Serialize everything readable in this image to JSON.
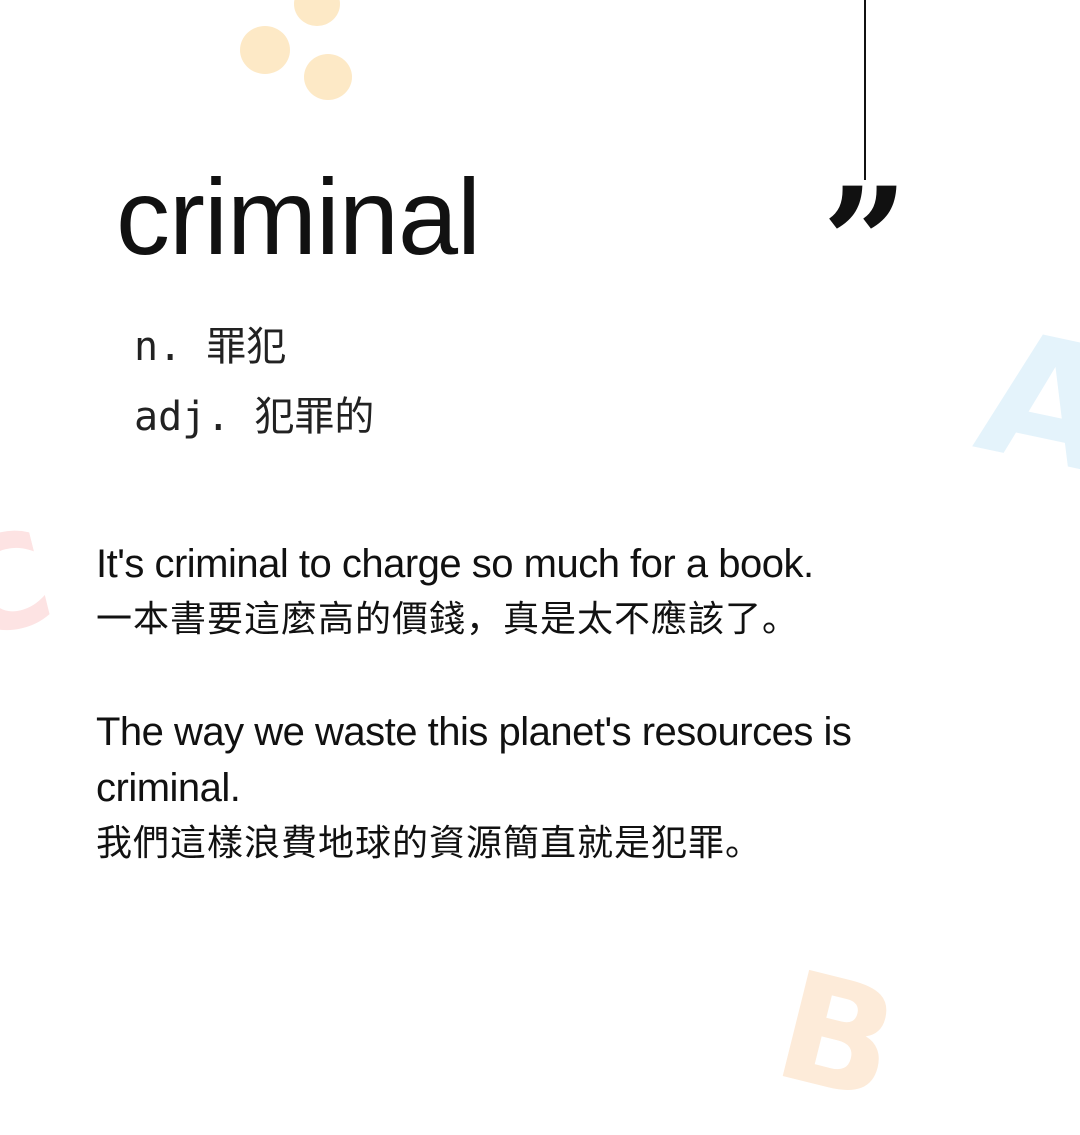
{
  "word": "criminal",
  "quote_icon": "closing-quote-icon",
  "definitions": [
    {
      "pos": "n.",
      "meaning": "罪犯"
    },
    {
      "pos": "adj.",
      "meaning": "犯罪的"
    }
  ],
  "examples": [
    {
      "en": "It's criminal to charge so much for a book.",
      "zh": "一本書要這麼高的價錢，真是太不應該了。"
    },
    {
      "en": "The way we waste this planet's resources is criminal.",
      "zh": "我們這樣浪費地球的資源簡直就是犯罪。"
    }
  ],
  "decor": {
    "letters": [
      "A",
      "C",
      "B"
    ],
    "colors": {
      "dots": "#fde9c6",
      "letter_a": "#e4f3fb",
      "letter_c": "#fde3e3",
      "letter_b": "#fdebd9"
    }
  }
}
